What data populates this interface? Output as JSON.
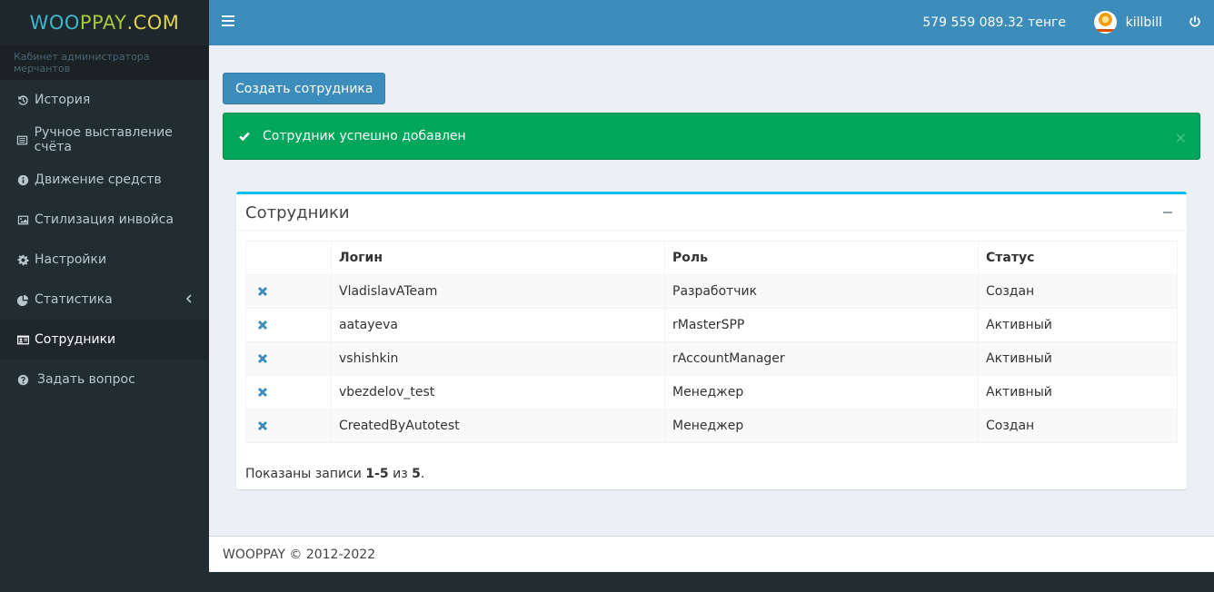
{
  "brand": {
    "part1": "WOO",
    "part2": "PPAY",
    "part3": ".COM"
  },
  "sidebar": {
    "caption": "Кабинет администратора мерчантов",
    "items": [
      {
        "label": "История",
        "icon": "history-icon",
        "active": false
      },
      {
        "label": "Ручное выставление счёта",
        "icon": "list-icon",
        "active": false
      },
      {
        "label": "Движение средств",
        "icon": "info-icon",
        "active": false
      },
      {
        "label": "Стилизация инвойса",
        "icon": "image-icon",
        "active": false
      },
      {
        "label": "Настройки",
        "icon": "gear-icon",
        "active": false
      },
      {
        "label": "Статистика",
        "icon": "pie-chart-icon",
        "active": false,
        "has_submenu": true
      },
      {
        "label": "Сотрудники",
        "icon": "id-card-icon",
        "active": true
      },
      {
        "label": "Задать вопрос",
        "icon": "question-icon",
        "active": false
      }
    ]
  },
  "header": {
    "balance": "579 559 089.32 тенге",
    "username": "killbill"
  },
  "main": {
    "create_button": "Создать сотрудника",
    "alert": {
      "message": "Сотрудник успешно добавлен",
      "close": "×",
      "color": "#00a65a"
    },
    "box": {
      "title": "Сотрудники",
      "columns": [
        "",
        "Логин",
        "Роль",
        "Статус"
      ],
      "rows": [
        {
          "login": "VladislavATeam",
          "role": "Разработчик",
          "status": "Создан"
        },
        {
          "login": "aatayeva",
          "role": "rMasterSPP",
          "status": "Активный"
        },
        {
          "login": "vshishkin",
          "role": "rAccountManager",
          "status": "Активный"
        },
        {
          "login": "vbezdelov_test",
          "role": "Менеджер",
          "status": "Активный"
        },
        {
          "login": "CreatedByAutotest",
          "role": "Менеджер",
          "status": "Создан"
        }
      ],
      "summary_prefix": "Показаны записи ",
      "summary_range": "1-5",
      "summary_mid": " из ",
      "summary_total": "5",
      "summary_suffix": "."
    }
  },
  "footer": {
    "text": "WOOPPAY © 2012-2022"
  },
  "colors": {
    "accent": "#3c8dbc",
    "sidebar": "#222d32",
    "box_top": "#00c0ef"
  }
}
